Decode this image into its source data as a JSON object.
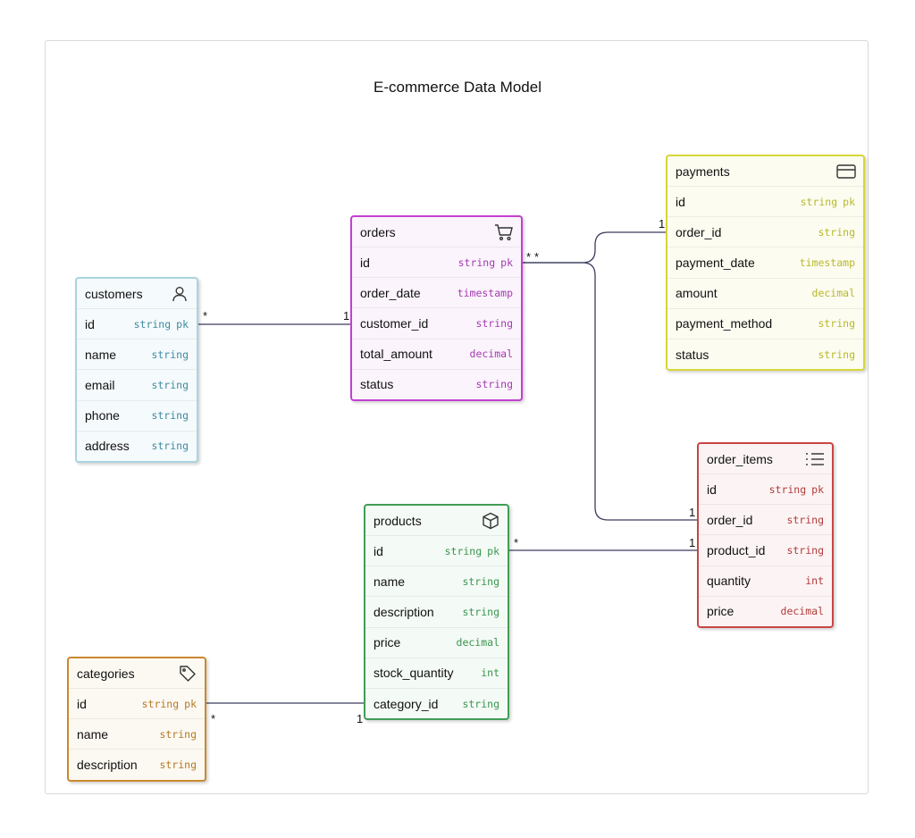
{
  "title": "E-commerce Data Model",
  "colors": {
    "customers": "#a9d4e0",
    "orders": "#c23fd0",
    "payments": "#d6d63a",
    "order_items": "#c94545",
    "products": "#3f9e55",
    "categories": "#c98a2e",
    "link": "#3b3c5e"
  },
  "entities": {
    "customers": {
      "name": "customers",
      "icon": "user-icon",
      "fields": [
        {
          "name": "id",
          "type": "string",
          "pk": "pk"
        },
        {
          "name": "name",
          "type": "string"
        },
        {
          "name": "email",
          "type": "string"
        },
        {
          "name": "phone",
          "type": "string"
        },
        {
          "name": "address",
          "type": "string"
        }
      ]
    },
    "orders": {
      "name": "orders",
      "icon": "shopping-cart-icon",
      "fields": [
        {
          "name": "id",
          "type": "string",
          "pk": "pk"
        },
        {
          "name": "order_date",
          "type": "timestamp"
        },
        {
          "name": "customer_id",
          "type": "string"
        },
        {
          "name": "total_amount",
          "type": "decimal"
        },
        {
          "name": "status",
          "type": "string"
        }
      ]
    },
    "payments": {
      "name": "payments",
      "icon": "credit-card-icon",
      "fields": [
        {
          "name": "id",
          "type": "string",
          "pk": "pk"
        },
        {
          "name": "order_id",
          "type": "string"
        },
        {
          "name": "payment_date",
          "type": "timestamp"
        },
        {
          "name": "amount",
          "type": "decimal"
        },
        {
          "name": "payment_method",
          "type": "string"
        },
        {
          "name": "status",
          "type": "string"
        }
      ]
    },
    "order_items": {
      "name": "order_items",
      "icon": "list-icon",
      "fields": [
        {
          "name": "id",
          "type": "string",
          "pk": "pk"
        },
        {
          "name": "order_id",
          "type": "string"
        },
        {
          "name": "product_id",
          "type": "string"
        },
        {
          "name": "quantity",
          "type": "int"
        },
        {
          "name": "price",
          "type": "decimal"
        }
      ]
    },
    "products": {
      "name": "products",
      "icon": "box-icon",
      "fields": [
        {
          "name": "id",
          "type": "string",
          "pk": "pk"
        },
        {
          "name": "name",
          "type": "string"
        },
        {
          "name": "description",
          "type": "string"
        },
        {
          "name": "price",
          "type": "decimal"
        },
        {
          "name": "stock_quantity",
          "type": "int"
        },
        {
          "name": "category_id",
          "type": "string"
        }
      ]
    },
    "categories": {
      "name": "categories",
      "icon": "tag-icon",
      "fields": [
        {
          "name": "id",
          "type": "string",
          "pk": "pk"
        },
        {
          "name": "name",
          "type": "string"
        },
        {
          "name": "description",
          "type": "string"
        }
      ]
    }
  },
  "relationships": [
    {
      "from": "customers.id",
      "to": "orders.customer_id",
      "from_card": "*",
      "to_card": "1"
    },
    {
      "from": "orders.id",
      "to": "payments.order_id",
      "from_card": "*",
      "to_card": "1"
    },
    {
      "from": "orders.id",
      "to": "order_items.order_id",
      "from_card": "*",
      "to_card": "1"
    },
    {
      "from": "products.id",
      "to": "order_items.product_id",
      "from_card": "*",
      "to_card": "1"
    },
    {
      "from": "categories.id",
      "to": "products.category_id",
      "from_card": "*",
      "to_card": "1"
    }
  ]
}
